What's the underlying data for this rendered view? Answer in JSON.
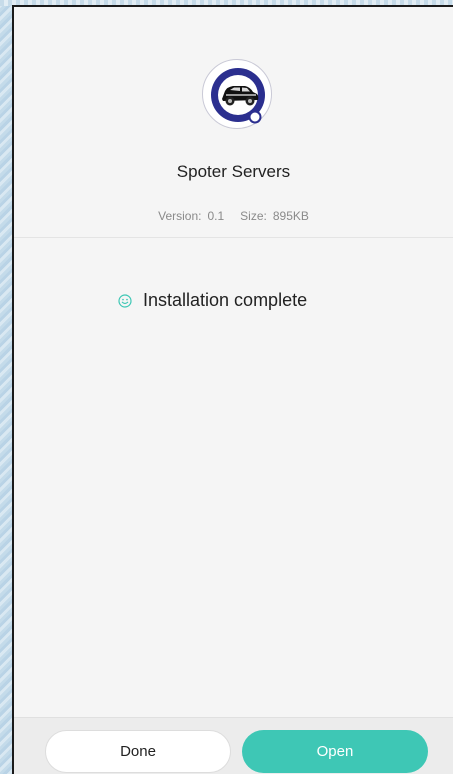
{
  "app": {
    "name": "Spoter Servers",
    "icon": "car-logo-icon"
  },
  "meta": {
    "version_label": "Version:",
    "version_value": "0.1",
    "size_label": "Size:",
    "size_value": "895KB"
  },
  "status": {
    "icon": "smile-icon",
    "text": "Installation complete"
  },
  "buttons": {
    "done_label": "Done",
    "open_label": "Open"
  },
  "colors": {
    "accent": "#3ec7b5",
    "icon_ring": "#2b2f8f"
  }
}
